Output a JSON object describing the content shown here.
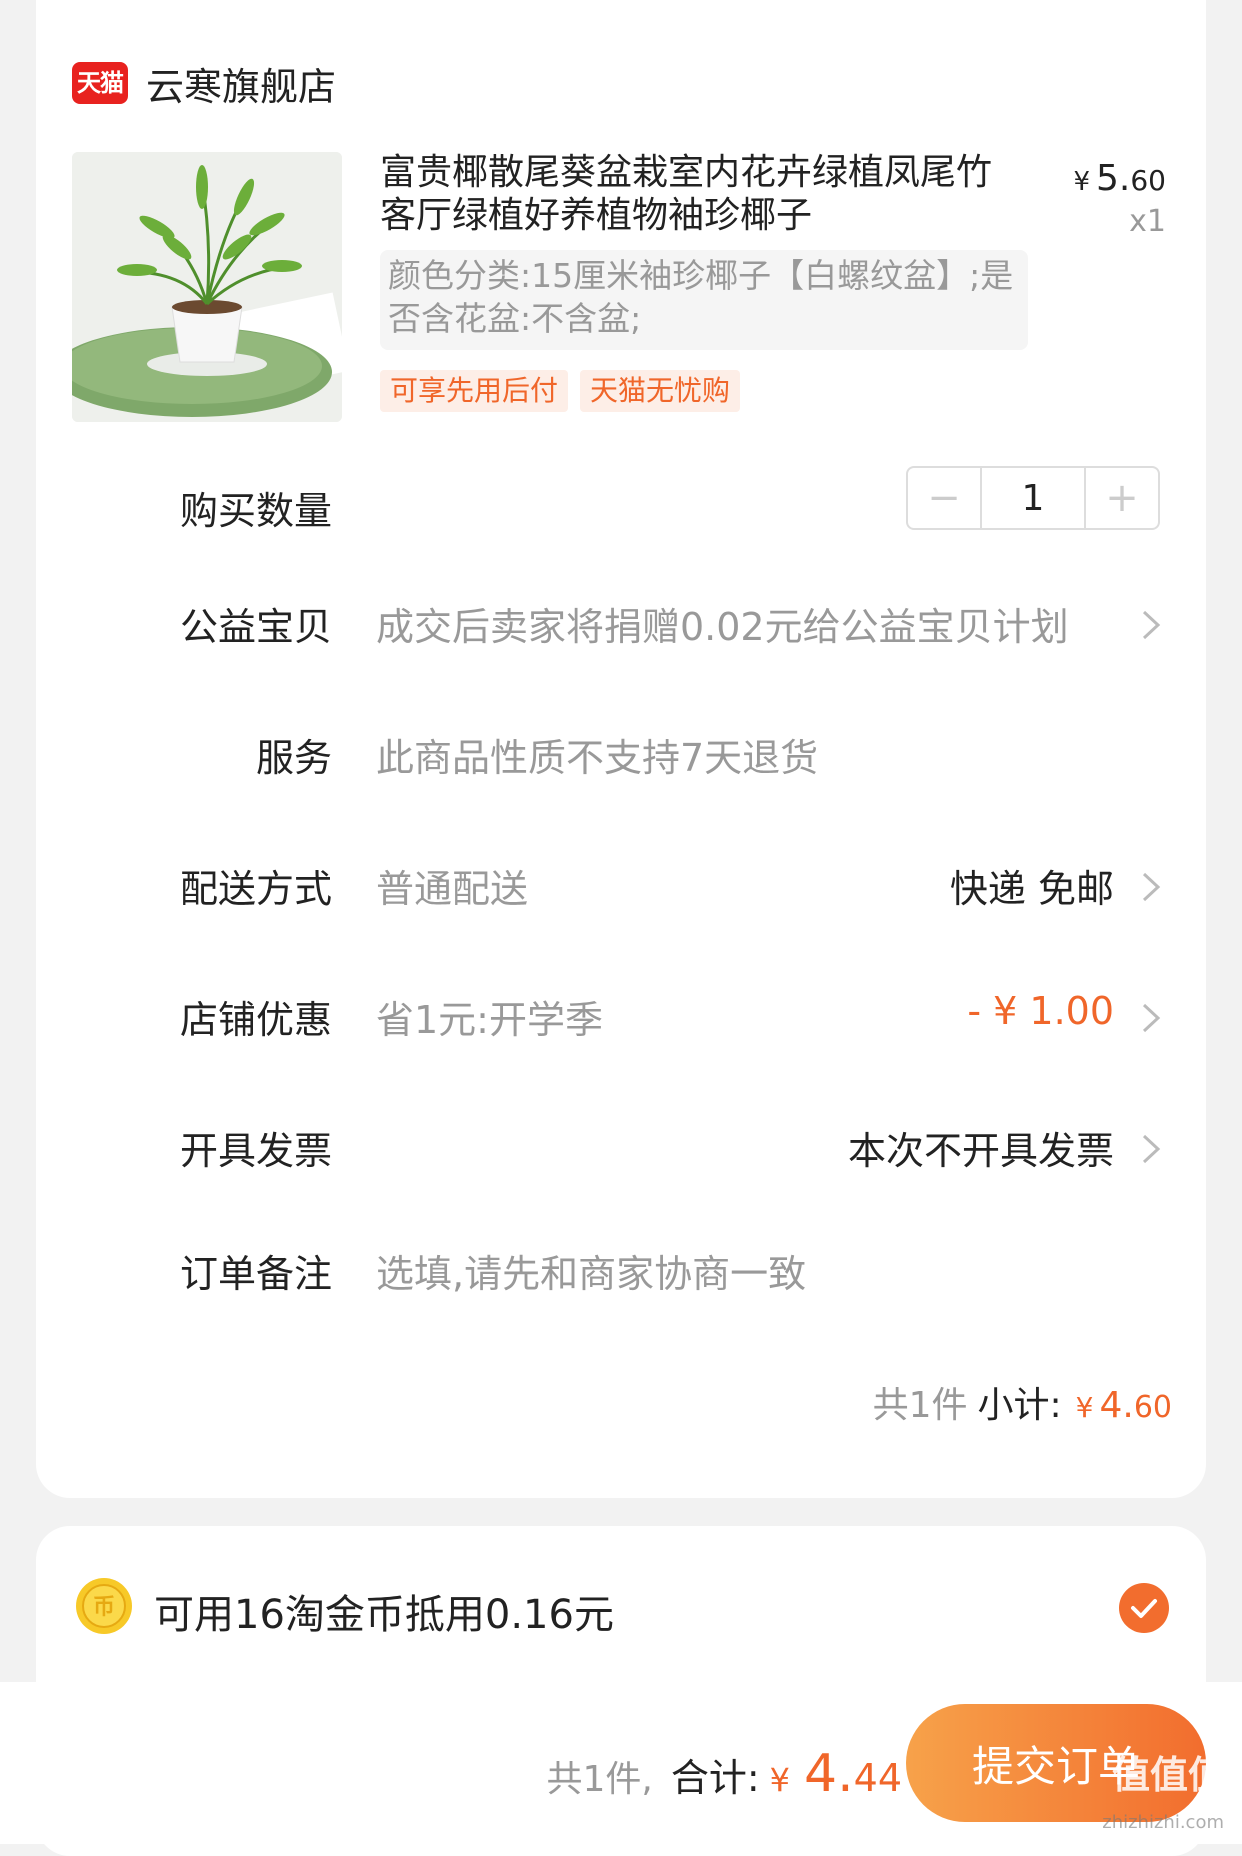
{
  "store": {
    "badge": "天猫",
    "name": "云寒旗舰店"
  },
  "product": {
    "title": "富贵椰散尾葵盆栽室内花卉绿植凤尾竹客厅绿植好养植物袖珍椰子",
    "price_symbol": "¥",
    "price_int": "5.",
    "price_dec": "60",
    "quantity": "x1",
    "sku": "颜色分类:15厘米袖珍椰子【白螺纹盆】;是否含花盆:不含盆;",
    "tags": [
      "可享先用后付",
      "天猫无忧购"
    ]
  },
  "rows": {
    "quantity": {
      "label": "购买数量",
      "value": "1",
      "minus": "−",
      "plus": "+"
    },
    "charity": {
      "label": "公益宝贝",
      "value": "成交后卖家将捐赠0.02元给公益宝贝计划"
    },
    "service": {
      "label": "服务",
      "value": "此商品性质不支持7天退货"
    },
    "delivery": {
      "label": "配送方式",
      "value": "普通配送",
      "right": "快递 免邮"
    },
    "discount": {
      "label": "店铺优惠",
      "value": "省1元:开学季",
      "right": "- ¥ 1.00"
    },
    "invoice": {
      "label": "开具发票",
      "right": "本次不开具发票"
    },
    "note": {
      "label": "订单备注",
      "placeholder": "选填,请先和商家协商一致"
    }
  },
  "subtotal": {
    "count": "共1件",
    "label": "小计:",
    "symbol": "¥",
    "int": "4.",
    "dec": "60"
  },
  "coins": {
    "text": "可用16淘金币抵用0.16元",
    "checked": true
  },
  "footer": {
    "count": "共1件,",
    "label": "合计:",
    "symbol": "¥",
    "int": "4.",
    "dec": "44",
    "submit": "提交订单"
  },
  "watermark": {
    "main": "值值值",
    "sub": "zhizhizhi.com"
  },
  "colors": {
    "accent": "#f0662a",
    "tmall_red": "#e8221f",
    "muted": "#999999"
  }
}
